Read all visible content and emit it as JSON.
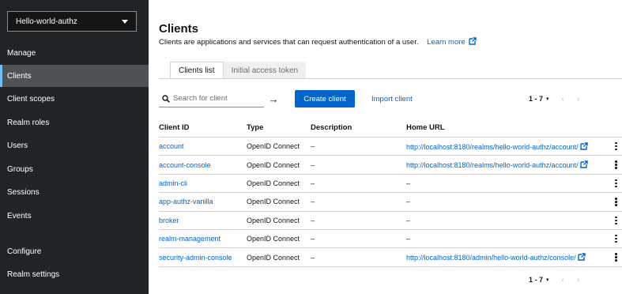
{
  "sidebar": {
    "realm": "Hello-world-authz",
    "manage_label": "Manage",
    "items": [
      {
        "label": "Clients"
      },
      {
        "label": "Client scopes"
      },
      {
        "label": "Realm roles"
      },
      {
        "label": "Users"
      },
      {
        "label": "Groups"
      },
      {
        "label": "Sessions"
      },
      {
        "label": "Events"
      }
    ],
    "configure_label": "Configure",
    "configure_items": [
      {
        "label": "Realm settings"
      }
    ]
  },
  "main": {
    "title": "Clients",
    "description": "Clients are applications and services that can request authentication of a user.",
    "learn_more": "Learn more",
    "tabs": [
      {
        "label": "Clients list"
      },
      {
        "label": "Initial access token"
      }
    ],
    "toolbar": {
      "search_placeholder": "Search for client",
      "search_arrow": "→",
      "create_label": "Create client",
      "import_label": "Import client",
      "pagination": "1 - 7",
      "pagination_dropdown": "▾",
      "prev": "‹",
      "next": "›"
    },
    "table": {
      "headers": [
        "Client ID",
        "Type",
        "Description",
        "Home URL"
      ],
      "rows": [
        {
          "client_id": "account",
          "type": "OpenID Connect",
          "description": "–",
          "home_url": "http://localhost:8180/realms/hello-world-authz/account/",
          "home_url_is_link": true
        },
        {
          "client_id": "account-console",
          "type": "OpenID Connect",
          "description": "–",
          "home_url": "http://localhost:8180/realms/hello-world-authz/account/",
          "home_url_is_link": true
        },
        {
          "client_id": "admin-cli",
          "type": "OpenID Connect",
          "description": "–",
          "home_url": "–",
          "home_url_is_link": false
        },
        {
          "client_id": "app-authz-vanilla",
          "type": "OpenID Connect",
          "description": "–",
          "home_url": "–",
          "home_url_is_link": false
        },
        {
          "client_id": "broker",
          "type": "OpenID Connect",
          "description": "–",
          "home_url": "–",
          "home_url_is_link": false
        },
        {
          "client_id": "realm-management",
          "type": "OpenID Connect",
          "description": "–",
          "home_url": "–",
          "home_url_is_link": false
        },
        {
          "client_id": "security-admin-console",
          "type": "OpenID Connect",
          "description": "–",
          "home_url": "http://localhost:8180/admin/hello-world-authz/console/",
          "home_url_is_link": true
        }
      ]
    }
  },
  "colors": {
    "sidebar_bg": "#212427",
    "active_nav_bg": "#4f5255",
    "active_nav_accent": "#73bcf7",
    "primary": "#0066cc",
    "link": "#0066cc"
  },
  "icons": {
    "realm_dropdown": "caret-down-icon",
    "learn_more": "external-link-icon",
    "search": "search-icon",
    "search_submit": "arrow-right-icon",
    "row_actions": "kebab-icon"
  }
}
